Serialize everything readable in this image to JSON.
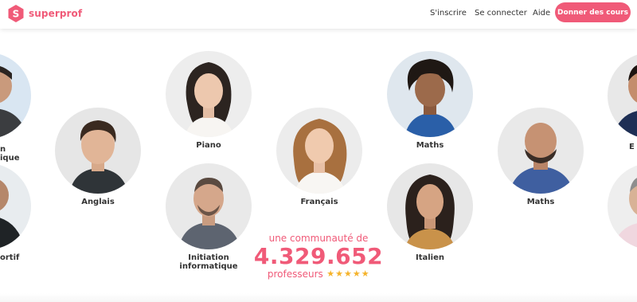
{
  "header": {
    "brand": "superprof",
    "brand_letter": "S",
    "nav_signup": "S'inscrire",
    "nav_login": "Se connecter",
    "nav_help": "Aide",
    "cta": "Donner des cours"
  },
  "tutors": [
    {
      "subject": "Piano"
    },
    {
      "subject": "Maths"
    },
    {
      "subject": "Anglais"
    },
    {
      "subject": "Français"
    },
    {
      "subject": "Maths"
    },
    {
      "subject": "Initiation informatique"
    },
    {
      "subject": "Italien"
    },
    {
      "subject": "n\nique"
    },
    {
      "subject": "ortif"
    },
    {
      "subject": "E"
    }
  ],
  "community": {
    "label": "une communauté de",
    "count": "4.329.652",
    "role": "professeurs",
    "rating": 5
  },
  "colors": {
    "brand": "#f05a78",
    "star": "#f5b32b",
    "text": "#333333"
  }
}
